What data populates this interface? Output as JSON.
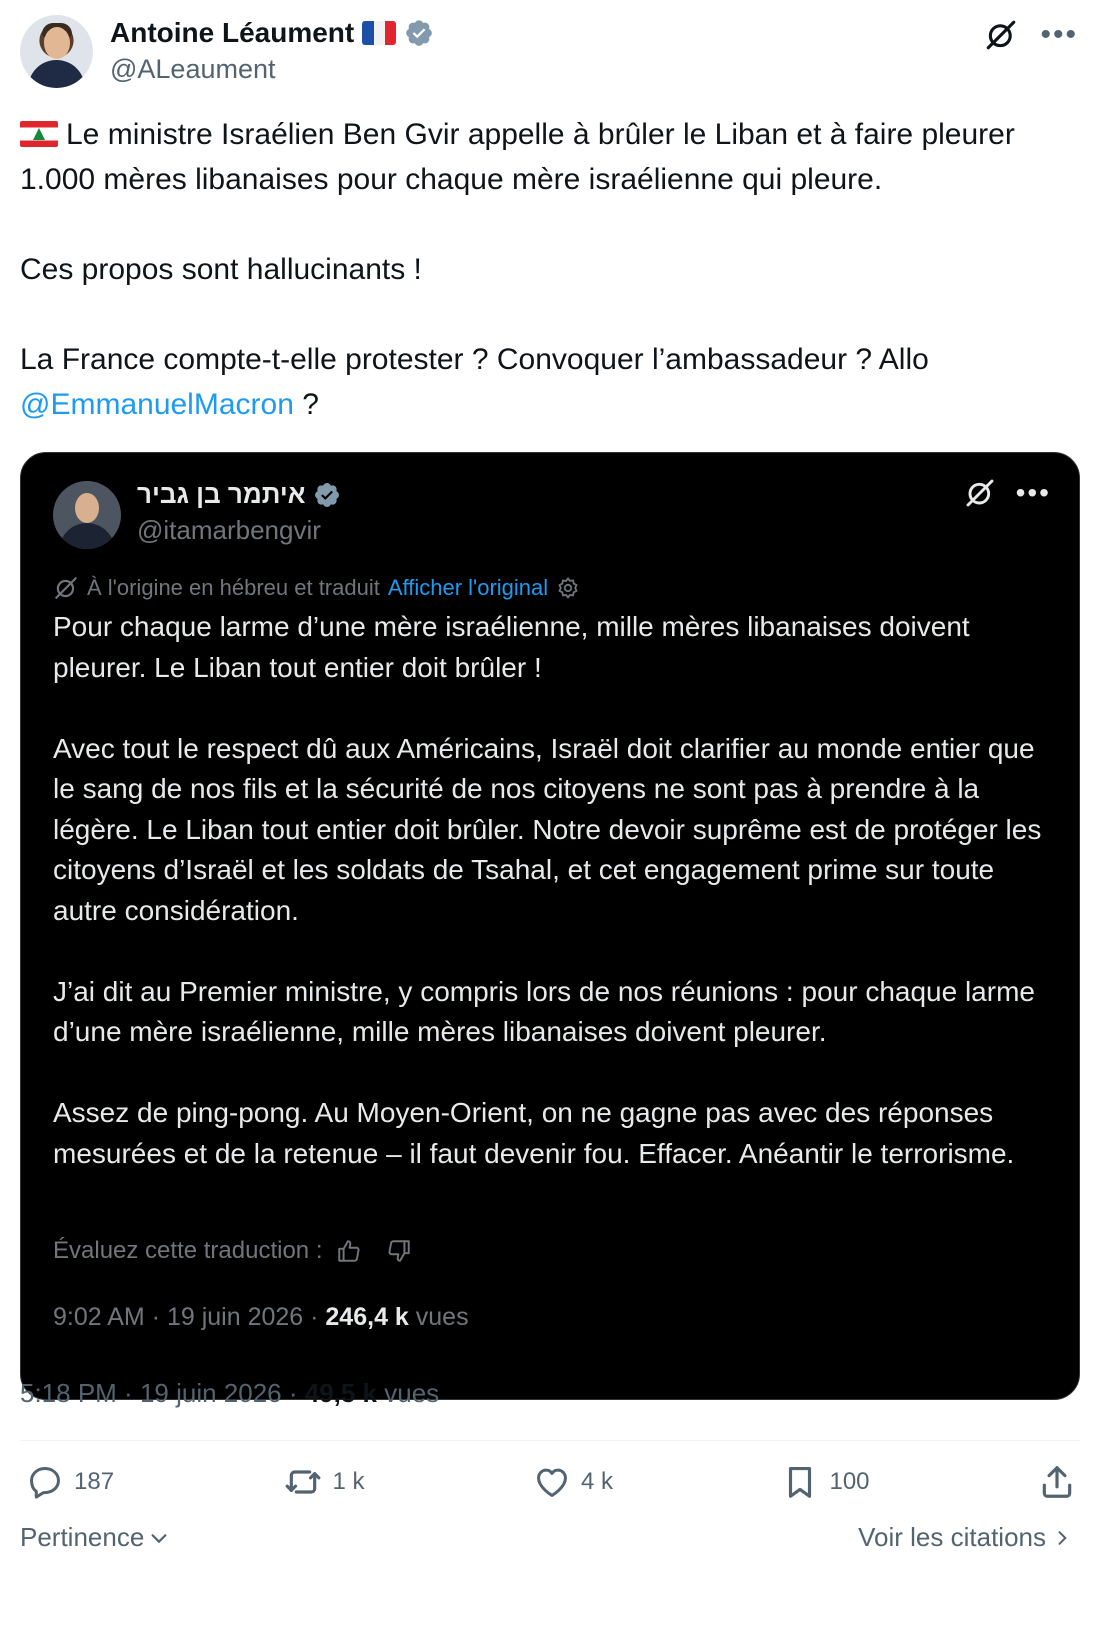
{
  "author": {
    "name": "Antoine Léaument",
    "handle": "@ALeaument"
  },
  "tweet": {
    "line1": "Le ministre Israélien Ben Gvir appelle à brûler le Liban et à faire pleurer 1.000 mères libanaises pour chaque mère israélienne qui pleure.",
    "line2": "Ces propos sont hallucinants !",
    "line3_a": "La France compte-t-elle protester ? Convoquer l’ambassadeur ? Allo",
    "mention": "@EmmanuelMacron",
    "line3_b": " ?"
  },
  "quoted": {
    "name": "איתמר בן גביר",
    "handle": "@itamarbengvir",
    "translated_note": "À l'origine en hébreu et traduit",
    "show_original": "Afficher l'original",
    "paragraphs": [
      "Pour chaque larme d’une mère israélienne, mille mères libanaises doivent pleurer. Le Liban tout entier doit brûler !",
      "Avec tout le respect dû aux Américains, Israël doit clarifier au monde entier que le sang de nos fils et la sécurité de nos citoyens ne sont pas à prendre à la légère. Le Liban tout entier doit brûler. Notre devoir suprême est de protéger les citoyens d’Israël et les soldats de Tsahal, et cet engagement prime sur toute autre considération.",
      "J’ai dit au Premier ministre, y compris lors de nos réunions : pour chaque larme d’une mère israélienne, mille mères libanaises doivent pleurer.",
      "Assez de ping-pong. Au Moyen-Orient, on ne gagne pas avec des réponses mesurées et de la retenue – il faut devenir fou. Effacer. Anéantir le terrorisme."
    ],
    "rate_label": "Évaluez cette traduction :",
    "time": "9:02 AM",
    "date": "19 juin 2026",
    "views_count": "246,4 k",
    "views_label": "vues"
  },
  "meta": {
    "time": "5:18 PM",
    "date": "19 juin 2026",
    "views_count": "49,5 k",
    "views_label": "vues"
  },
  "actions": {
    "replies": "187",
    "reposts": "1 k",
    "likes": "4 k",
    "bookmarks": "100"
  },
  "footer": {
    "sort_label": "Pertinence",
    "quotes_label": "Voir les citations"
  },
  "colors": {
    "accent": "#1d9bf0",
    "verified": "#829aab",
    "text": "#0f1419",
    "muted": "#536471"
  },
  "icons": [
    "grok-icon",
    "more-icon",
    "verified-icon",
    "reply-icon",
    "repost-icon",
    "like-icon",
    "bookmark-icon",
    "share-icon",
    "thumbs-up-icon",
    "thumbs-down-icon",
    "settings-icon",
    "translate-icon",
    "chevron-down-icon",
    "chevron-right-icon"
  ]
}
